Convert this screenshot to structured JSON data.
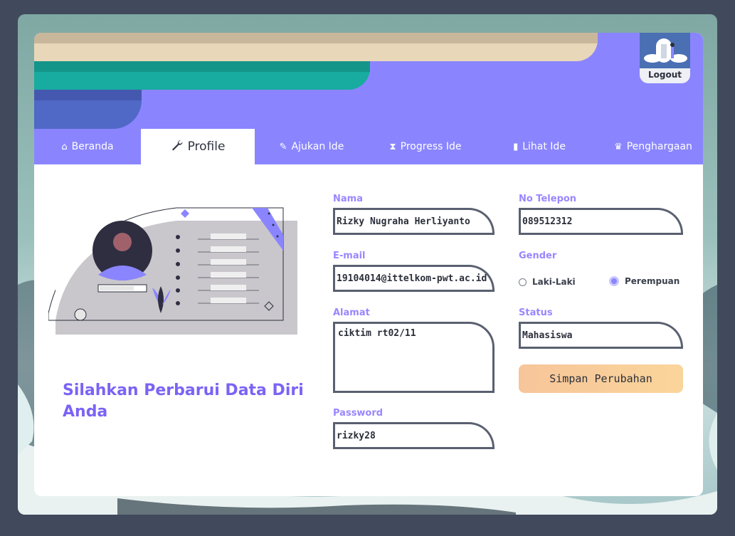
{
  "header": {
    "logout_label": "Logout"
  },
  "nav": {
    "tabs": [
      {
        "label": "Beranda",
        "icon": "home-icon"
      },
      {
        "label": "Profile",
        "icon": "wrench-icon",
        "active": true
      },
      {
        "label": "Ajukan Ide",
        "icon": "edit-icon"
      },
      {
        "label": "Progress Ide",
        "icon": "hourglass-icon"
      },
      {
        "label": "Lihat Ide",
        "icon": "clipboard-icon"
      },
      {
        "label": "Penghargaan",
        "icon": "trophy-icon"
      }
    ]
  },
  "main": {
    "headline": "Silahkan Perbarui Data Diri Anda"
  },
  "form": {
    "nama": {
      "label": "Nama",
      "value": "Rizky Nugraha Herliyanto"
    },
    "email": {
      "label": "E-mail",
      "value": "19104014@ittelkom-pwt.ac.id"
    },
    "alamat": {
      "label": "Alamat",
      "value": "ciktim rt02/11"
    },
    "password": {
      "label": "Password",
      "value": "rizky28"
    },
    "telepon": {
      "label": "No Telepon",
      "value": "089512312"
    },
    "gender": {
      "label": "Gender",
      "options": [
        "Laki-Laki",
        "Perempuan"
      ],
      "selected": "Perempuan"
    },
    "status": {
      "label": "Status",
      "value": "Mahasiswa"
    },
    "save_label": "Simpan Perubahan"
  },
  "colors": {
    "accent": "#8a85ff",
    "headline": "#7b63f5",
    "button": "#f9cf9a",
    "background": "#414a5c"
  }
}
